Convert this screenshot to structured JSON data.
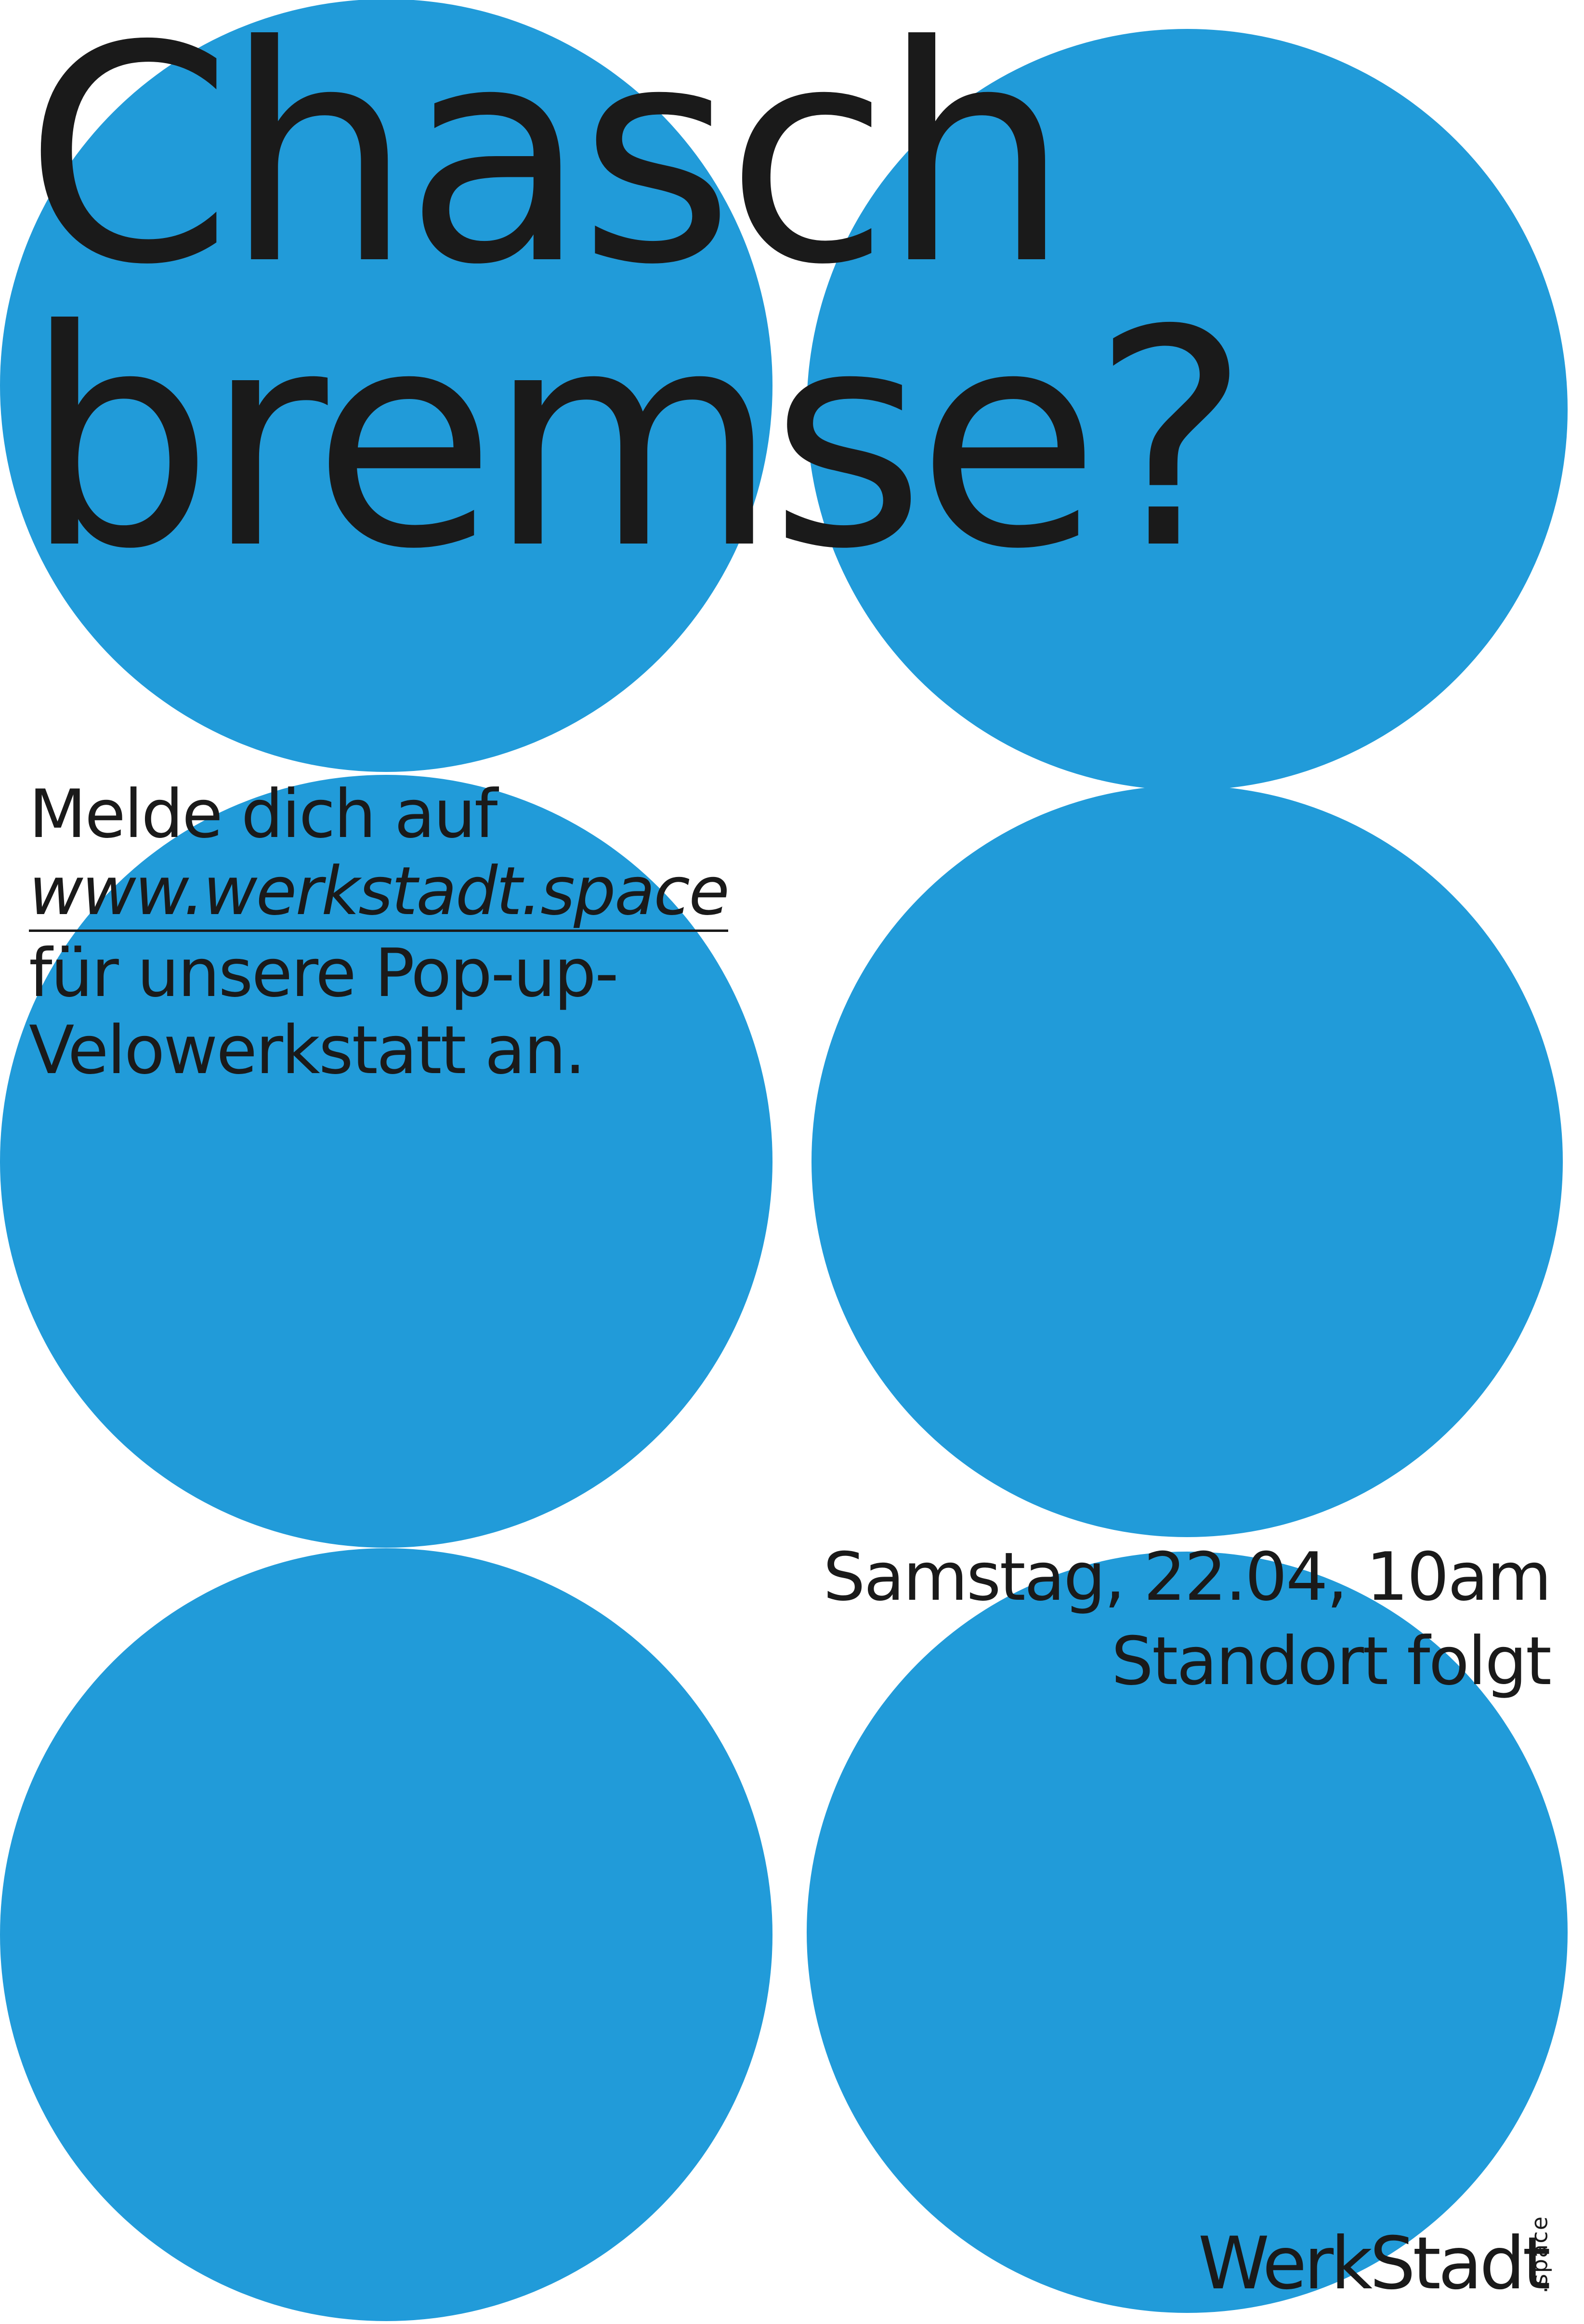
{
  "headline": {
    "line1": "Chasch",
    "line2": "bremse?"
  },
  "intro": {
    "line1": "Melde dich auf",
    "url": "www.werkstadt.space",
    "line3": "für unsere Pop-up-",
    "line4": "Velowerkstatt an."
  },
  "event": {
    "date_line": "Samstag, 22.04, 10am",
    "location_line": "Standort folgt"
  },
  "logo": {
    "name": "WerkStadt",
    "suffix": ".space"
  },
  "colors": {
    "circle_blue": "#219bd9",
    "text": "#1a1a1a",
    "background": "#ffffff"
  }
}
